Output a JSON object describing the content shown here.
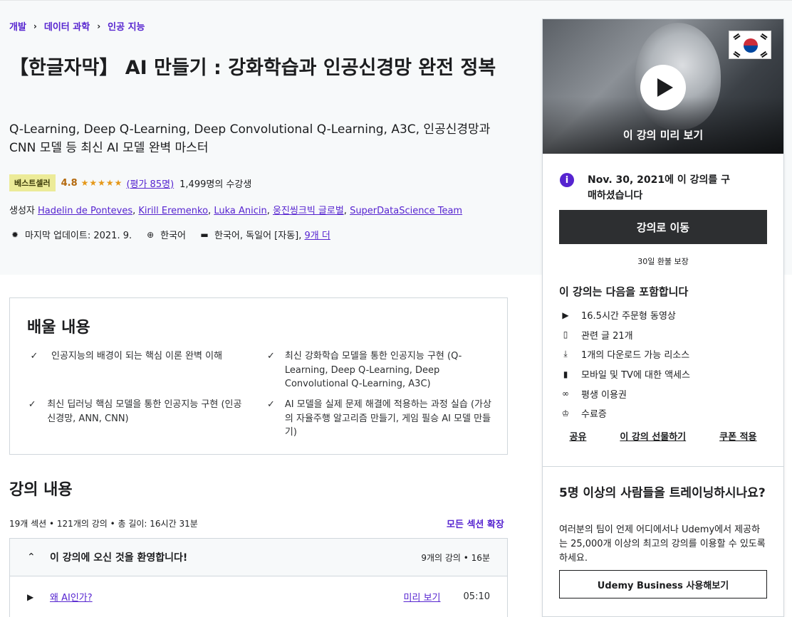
{
  "breadcrumb": [
    "개발",
    "데이터 과학",
    "인공 지능"
  ],
  "course": {
    "title": "【한글자막】 AI 만들기 : 강화학습과 인공신경망 완전 정복",
    "subtitle": "Q-Learning, Deep Q-Learning, Deep Convolutional Q-Learning, A3C, 인공신경망과 CNN 모델 등 최신 AI 모델 완벽 마스터",
    "badge": "베스트셀러",
    "rating": "4.8",
    "stars": "★★★★★",
    "rating_count": "(평가 85명)",
    "students": "1,499명의 수강생",
    "created_by_label": "생성자",
    "instructors": [
      "Hadelin de Ponteves",
      "Kirill Eremenko",
      "Luka Anicin",
      "웅진씽크빅 글로벌",
      "SuperDataScience Team"
    ],
    "last_updated": "마지막 업데이트: 2021. 9.",
    "language": "한국어",
    "captions": "한국어, 독일어 [자동],",
    "captions_more": "9개 더"
  },
  "sidebar": {
    "preview_label": "이 강의 미리 보기",
    "purchased_text": "Nov. 30, 2021에 이 강의를 구매하셨습니다",
    "go_button": "강의로 이동",
    "guarantee": "30일 환불 보장",
    "includes_title": "이 강의는 다음을 포함합니다",
    "includes": [
      {
        "icon": "video-icon",
        "text": "16.5시간 주문형 동영상"
      },
      {
        "icon": "file-icon",
        "text": "관련 글 21개"
      },
      {
        "icon": "download-icon",
        "text": "1개의 다운로드 가능 리소스"
      },
      {
        "icon": "mobile-icon",
        "text": "모바일 및 TV에 대한 액세스"
      },
      {
        "icon": "infinity-icon",
        "text": "평생 이용권"
      },
      {
        "icon": "trophy-icon",
        "text": "수료증"
      }
    ],
    "actions": [
      "공유",
      "이 강의 선물하기",
      "쿠폰 적용"
    ],
    "business_title": "5명 이상의 사람들을 트레이닝하시나요?",
    "business_text": "여러분의 팀이 언제 어디에서나 Udemy에서 제공하는 25,000개 이상의 최고의 강의를 이용할 수 있도록 하세요.",
    "business_button": "Udemy Business 사용해보기"
  },
  "learn": {
    "title": "배울 내용",
    "items": [
      "인공지능의 배경이 되는 핵심 이론 완벽 이해",
      "최신 강화학습 모델을 통한 인공지능 구현 (Q-Learning, Deep Q-Learning, Deep Convolutional Q-Learning, A3C)",
      "최신 딥러닝 핵심 모델을 통한 인공지능 구현 (인공신경망, ANN, CNN)",
      "AI 모델을 실제 문제 해결에 적용하는 과정 실습 (가상의 자율주행 알고리즘 만들기, 게임 필승 AI 모델 만들기)"
    ]
  },
  "content": {
    "title": "강의 내용",
    "stats": "19개 섹션 • 121개의 강의 • 총 길이: 16시간 31분",
    "expand_all": "모든 섹션 확장",
    "section_title": "이 강의에 오신 것을 환영합니다!",
    "section_meta": "9개의 강의 • 16분",
    "lecture_title": "왜 AI인가?",
    "lecture_preview": "미리 보기",
    "lecture_duration": "05:10"
  }
}
